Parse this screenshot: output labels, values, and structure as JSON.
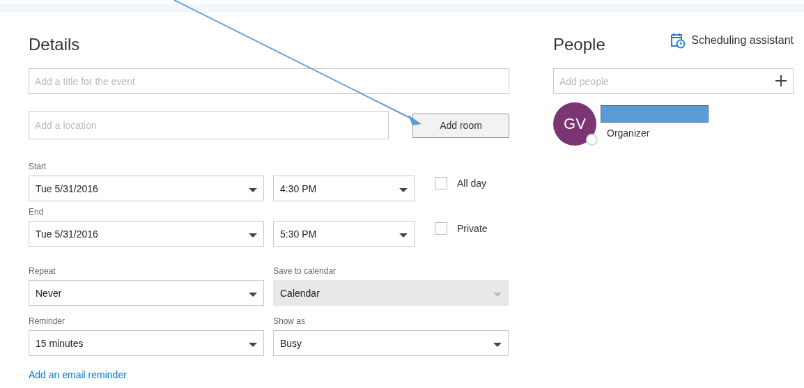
{
  "details": {
    "heading": "Details",
    "title_field": {
      "placeholder": "Add a title for the event"
    },
    "location_field": {
      "placeholder": "Add a location"
    },
    "add_room_button": "Add room",
    "time_rows": [
      {
        "label": "Start",
        "date": "Tue 5/31/2016",
        "time": "4:30 PM",
        "option": {
          "label": "All day",
          "checked": false
        }
      },
      {
        "label": "End",
        "date": "Tue 5/31/2016",
        "time": "5:30 PM",
        "option": {
          "label": "Private",
          "checked": false
        }
      }
    ],
    "dropdown_rows": [
      [
        {
          "label": "Repeat",
          "value": "Never",
          "disabled": false
        },
        {
          "label": "Save to calendar",
          "value": "Calendar",
          "disabled": true
        }
      ],
      [
        {
          "label": "Reminder",
          "value": "15 minutes",
          "disabled": false
        },
        {
          "label": "Show as",
          "value": "Busy",
          "disabled": false
        }
      ]
    ],
    "email_reminder_link": "Add an email reminder"
  },
  "people": {
    "heading": "People",
    "scheduling_assistant": "Scheduling assistant",
    "add_people": {
      "placeholder": "Add people"
    },
    "attendees": [
      {
        "initials": "GV",
        "role": "Organizer"
      }
    ]
  }
}
